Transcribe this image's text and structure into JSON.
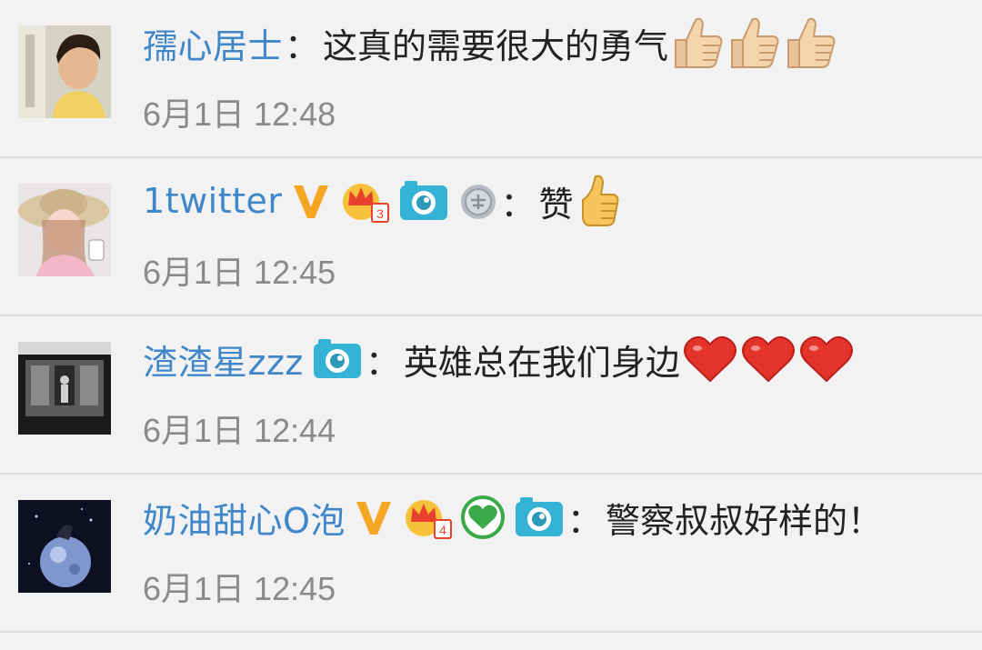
{
  "comments": [
    {
      "username": "孺心居士",
      "text": "这真的需要很大的勇气",
      "time": "6月1日 12:48",
      "badges": [],
      "emojis": [
        "thumbs-up",
        "thumbs-up",
        "thumbs-up"
      ]
    },
    {
      "username": "1twitter",
      "text": "赞",
      "time": "6月1日 12:45",
      "badges": [
        "verified-v-icon",
        "vip-crown-icon",
        "camera-icon",
        "medal-icon"
      ],
      "vip_level": "3",
      "emojis": [
        "thumbs-up"
      ]
    },
    {
      "username": "渣渣星zzz",
      "text": "英雄总在我们身边",
      "time": "6月1日 12:44",
      "badges": [
        "camera-icon"
      ],
      "emojis": [
        "heart",
        "heart",
        "heart"
      ]
    },
    {
      "username": "奶油甜心O泡",
      "text": "警察叔叔好样的！",
      "time": "6月1日 12:45",
      "badges": [
        "verified-v-icon",
        "vip-crown-icon",
        "green-heart-icon",
        "camera-icon"
      ],
      "vip_level": "4",
      "emojis": []
    }
  ],
  "colors": {
    "username": "#3f87c9",
    "timestamp": "#8a8a8a",
    "background": "#f2f2f2",
    "verified_v": "#f5a623",
    "camera_badge": "#35b3d6",
    "heart": "#e3332b"
  }
}
